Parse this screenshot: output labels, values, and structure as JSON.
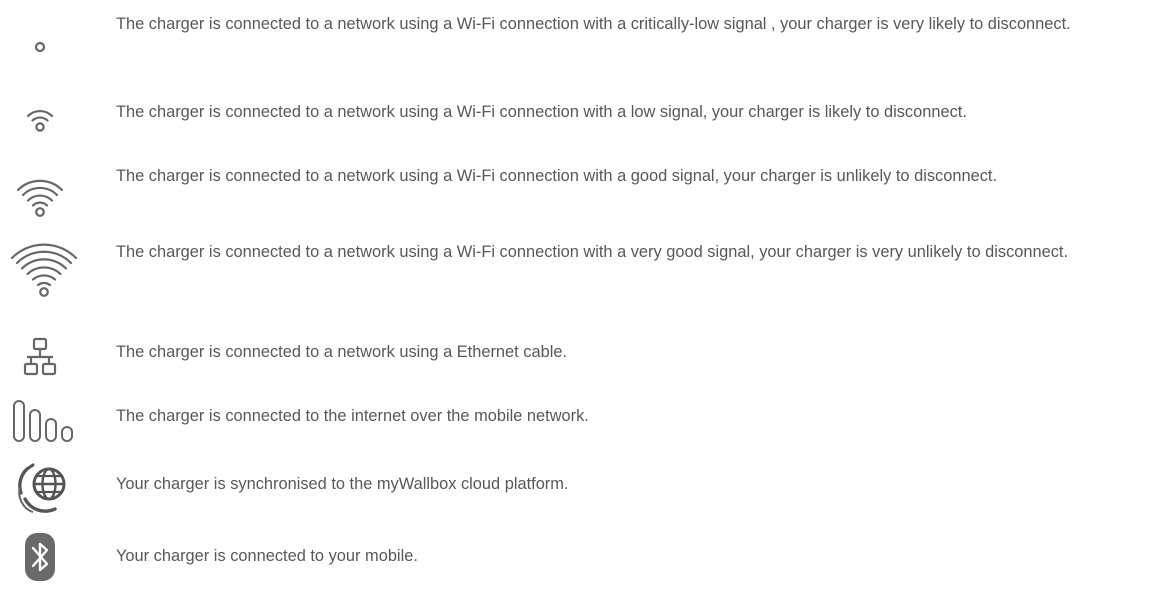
{
  "items": [
    {
      "icon": "wifi-critical-signal-icon",
      "text": "The charger is connected to a network using a Wi-Fi connection with a critically-low signal , your charger is very likely to disconnect."
    },
    {
      "icon": "wifi-low-signal-icon",
      "text": "The charger is connected to a network using a Wi-Fi connection with a low signal, your charger is likely to disconnect."
    },
    {
      "icon": "wifi-good-signal-icon",
      "text": "The charger is connected to a network using a Wi-Fi connection with a good signal, your charger is unlikely to disconnect."
    },
    {
      "icon": "wifi-very-good-signal-icon",
      "text": "The charger is connected to a network using a Wi-Fi connection with a very good signal, your charger is very unlikely to disconnect."
    },
    {
      "icon": "ethernet-network-icon",
      "text": "The charger is connected to a network using a Ethernet cable."
    },
    {
      "icon": "mobile-network-signal-icon",
      "text": "The charger is connected to the internet over the mobile network."
    },
    {
      "icon": "cloud-sync-globe-icon",
      "text": "Your charger is synchronised to the myWallbox cloud platform."
    },
    {
      "icon": "bluetooth-icon",
      "text": "Your charger is connected to your mobile."
    }
  ],
  "colors": {
    "text": "#585858",
    "icon_stroke": "#666666",
    "icon_fill_dark": "#6a6a6a"
  }
}
